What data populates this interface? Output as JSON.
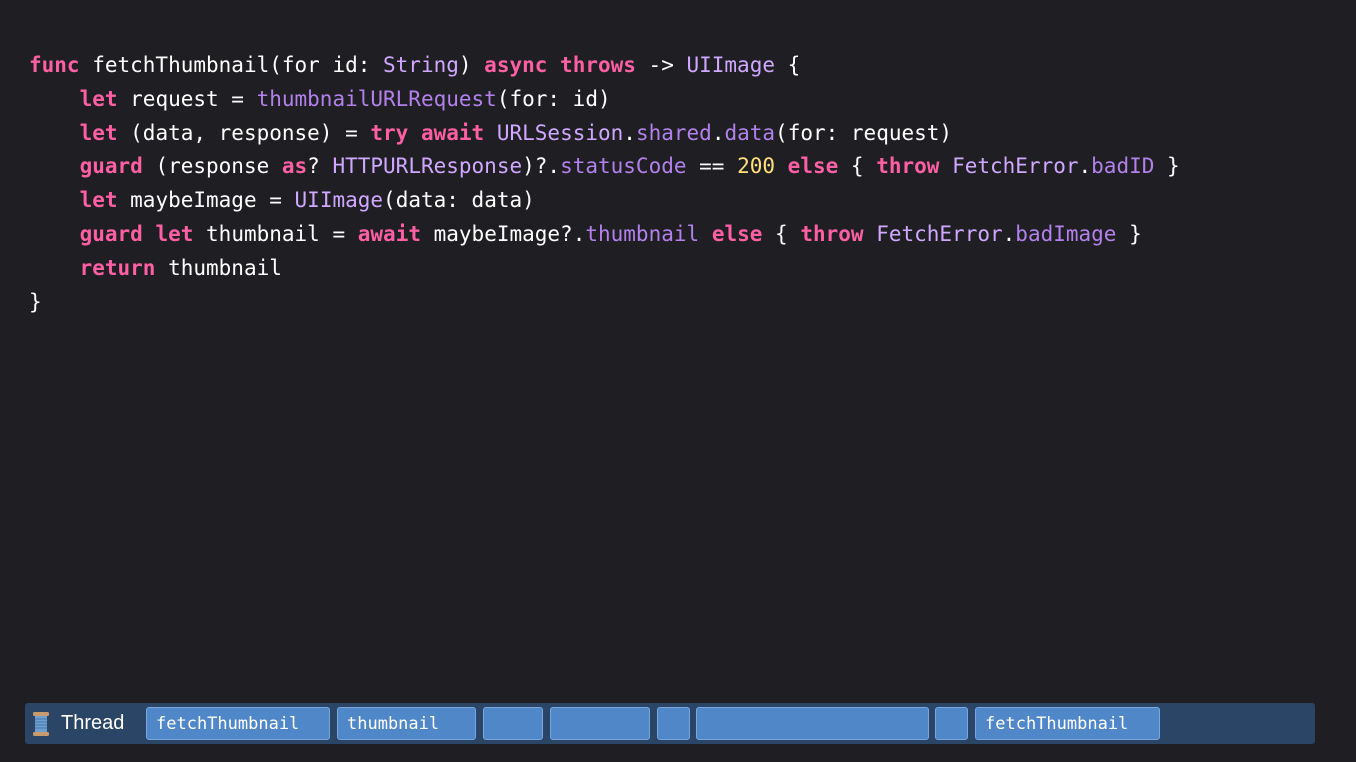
{
  "code": {
    "lines": [
      [
        {
          "t": "func",
          "c": "kw"
        },
        {
          "t": " fetchThumbnail(for id: ",
          "c": "pl"
        },
        {
          "t": "String",
          "c": "ty"
        },
        {
          "t": ") ",
          "c": "pl"
        },
        {
          "t": "async",
          "c": "kw"
        },
        {
          "t": " ",
          "c": "pl"
        },
        {
          "t": "throws",
          "c": "kw"
        },
        {
          "t": " -> ",
          "c": "pl"
        },
        {
          "t": "UIImage",
          "c": "ty"
        },
        {
          "t": " {",
          "c": "pl"
        }
      ],
      [
        {
          "t": "    ",
          "c": "pl"
        },
        {
          "t": "let",
          "c": "kw"
        },
        {
          "t": " request = ",
          "c": "pl"
        },
        {
          "t": "thumbnailURLRequest",
          "c": "fn"
        },
        {
          "t": "(for: id)",
          "c": "pl"
        }
      ],
      [
        {
          "t": "    ",
          "c": "pl"
        },
        {
          "t": "let",
          "c": "kw"
        },
        {
          "t": " (data, response) = ",
          "c": "pl"
        },
        {
          "t": "try",
          "c": "kw"
        },
        {
          "t": " ",
          "c": "pl"
        },
        {
          "t": "await",
          "c": "kw"
        },
        {
          "t": " ",
          "c": "pl"
        },
        {
          "t": "URLSession",
          "c": "ty"
        },
        {
          "t": ".",
          "c": "pl"
        },
        {
          "t": "shared",
          "c": "fn"
        },
        {
          "t": ".",
          "c": "pl"
        },
        {
          "t": "data",
          "c": "fn"
        },
        {
          "t": "(for: request)",
          "c": "pl"
        }
      ],
      [
        {
          "t": "    ",
          "c": "pl"
        },
        {
          "t": "guard",
          "c": "kw"
        },
        {
          "t": " (response ",
          "c": "pl"
        },
        {
          "t": "as",
          "c": "kw"
        },
        {
          "t": "? ",
          "c": "pl"
        },
        {
          "t": "HTTPURLResponse",
          "c": "ty"
        },
        {
          "t": ")?.",
          "c": "pl"
        },
        {
          "t": "statusCode",
          "c": "fn"
        },
        {
          "t": " == ",
          "c": "pl"
        },
        {
          "t": "200",
          "c": "num"
        },
        {
          "t": " ",
          "c": "pl"
        },
        {
          "t": "else",
          "c": "kw"
        },
        {
          "t": " { ",
          "c": "pl"
        },
        {
          "t": "throw",
          "c": "kw"
        },
        {
          "t": " ",
          "c": "pl"
        },
        {
          "t": "FetchError",
          "c": "ty"
        },
        {
          "t": ".",
          "c": "pl"
        },
        {
          "t": "badID",
          "c": "fn"
        },
        {
          "t": " }",
          "c": "pl"
        }
      ],
      [
        {
          "t": "    ",
          "c": "pl"
        },
        {
          "t": "let",
          "c": "kw"
        },
        {
          "t": " maybeImage = ",
          "c": "pl"
        },
        {
          "t": "UIImage",
          "c": "ty"
        },
        {
          "t": "(data: data)",
          "c": "pl"
        }
      ],
      [
        {
          "t": "    ",
          "c": "pl"
        },
        {
          "t": "guard",
          "c": "kw"
        },
        {
          "t": " ",
          "c": "pl"
        },
        {
          "t": "let",
          "c": "kw"
        },
        {
          "t": " thumbnail = ",
          "c": "pl"
        },
        {
          "t": "await",
          "c": "kw"
        },
        {
          "t": " maybeImage?.",
          "c": "pl"
        },
        {
          "t": "thumbnail",
          "c": "fn"
        },
        {
          "t": " ",
          "c": "pl"
        },
        {
          "t": "else",
          "c": "kw"
        },
        {
          "t": " { ",
          "c": "pl"
        },
        {
          "t": "throw",
          "c": "kw"
        },
        {
          "t": " ",
          "c": "pl"
        },
        {
          "t": "FetchError",
          "c": "ty"
        },
        {
          "t": ".",
          "c": "pl"
        },
        {
          "t": "badImage",
          "c": "fn"
        },
        {
          "t": " }",
          "c": "pl"
        }
      ],
      [
        {
          "t": "    ",
          "c": "pl"
        },
        {
          "t": "return",
          "c": "kw"
        },
        {
          "t": " thumbnail",
          "c": "pl"
        }
      ],
      [
        {
          "t": "}",
          "c": "pl"
        }
      ]
    ]
  },
  "thread_bar": {
    "label": "Thread",
    "icon": "spool-icon",
    "segments": [
      {
        "label": "fetchThumbnail"
      },
      {
        "label": "thumbnail"
      },
      {
        "label": ""
      },
      {
        "label": ""
      },
      {
        "label": ""
      },
      {
        "label": ""
      },
      {
        "label": ""
      },
      {
        "label": "fetchThumbnail"
      }
    ]
  },
  "colors": {
    "background": "#1f1f23",
    "keyword": "#fc5fa3",
    "type": "#d0a8ff",
    "function": "#b281eb",
    "number": "#ffe17a",
    "plain": "#ffffff",
    "thread_bar": "#2b4566",
    "segment": "#4f87c9"
  }
}
